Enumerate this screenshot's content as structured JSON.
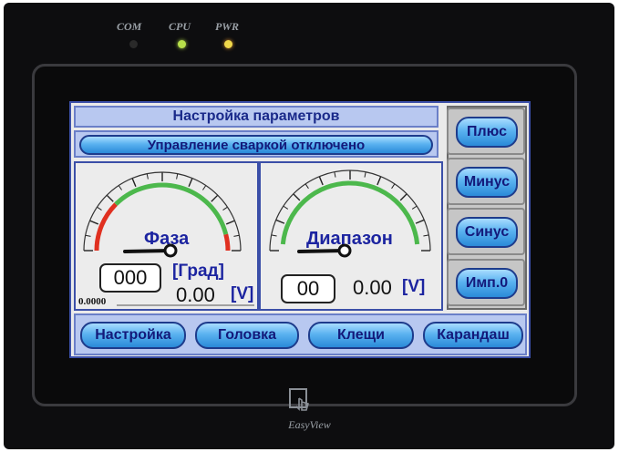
{
  "device": {
    "leds": [
      {
        "label": "COM",
        "color": "#2a2a2a"
      },
      {
        "label": "CPU",
        "color": "#b8e04a"
      },
      {
        "label": "PWR",
        "color": "#f0d84a"
      }
    ],
    "brand": "EasyView"
  },
  "screen": {
    "title": "Настройка параметров",
    "status": "Управление сваркой отключено",
    "gauge_left": {
      "name": "Фаза",
      "value_box": "000",
      "unit_top": "[Град]",
      "reading": "0.00",
      "reading_unit": "[V]",
      "baseline_value": "0.0000",
      "needle_fraction": 0.5,
      "zone_colors": {
        "red": "#e03020",
        "green": "#4cb84c"
      }
    },
    "gauge_right": {
      "name": "Диапазон",
      "value_box": "00",
      "reading": "0.00",
      "reading_unit": "[V]",
      "needle_fraction": 0.5,
      "zone_colors": {
        "green": "#4cb84c"
      }
    },
    "side_buttons": [
      "Плюс",
      "Минус",
      "Синус",
      "Имп.0"
    ],
    "bottom_buttons": [
      "Настройка",
      "Головка",
      "Клещи",
      "Карандаш"
    ]
  }
}
